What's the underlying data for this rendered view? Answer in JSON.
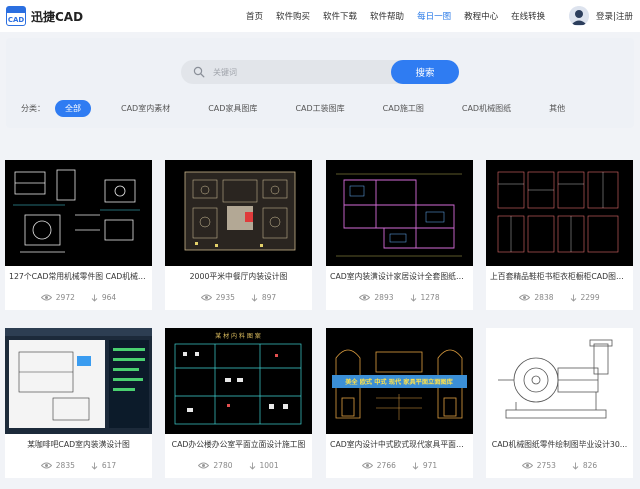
{
  "header": {
    "logo_badge": "CAD",
    "logo_text": "迅捷CAD",
    "nav": [
      {
        "label": "首页",
        "active": false
      },
      {
        "label": "软件购买",
        "active": false
      },
      {
        "label": "软件下载",
        "active": false
      },
      {
        "label": "软件帮助",
        "active": false
      },
      {
        "label": "每日一图",
        "active": true
      },
      {
        "label": "教程中心",
        "active": false
      },
      {
        "label": "在线转换",
        "active": false
      }
    ],
    "login": "登录|注册"
  },
  "search": {
    "placeholder": "关键词",
    "button": "搜索"
  },
  "categories": {
    "label": "分类：",
    "items": [
      {
        "label": "全部",
        "active": true
      },
      {
        "label": "CAD室内素材",
        "active": false
      },
      {
        "label": "CAD家具图库",
        "active": false
      },
      {
        "label": "CAD工装图库",
        "active": false
      },
      {
        "label": "CAD施工图",
        "active": false
      },
      {
        "label": "CAD机械图纸",
        "active": false
      },
      {
        "label": "其他",
        "active": false
      }
    ]
  },
  "cards": [
    {
      "title": "127个CAD常用机械零件图 CAD机械零...",
      "views": "2972",
      "downloads": "964"
    },
    {
      "title": "2000平米中餐厅内装设计图",
      "views": "2935",
      "downloads": "897"
    },
    {
      "title": "CAD室内装潢设计家居设计全套图纸案例",
      "views": "2893",
      "downloads": "1278"
    },
    {
      "title": "上百套精品鞋柜书柜衣柜橱柜CAD图库...",
      "views": "2838",
      "downloads": "2299"
    },
    {
      "title": "某咖啡吧CAD室内装潢设计图",
      "views": "2835",
      "downloads": "617"
    },
    {
      "title": "CAD办公楼办公室平面立面设计施工图",
      "views": "2780",
      "downloads": "1001"
    },
    {
      "title": "CAD室内设计中式欧式现代家具平面立...",
      "views": "2766",
      "downloads": "971"
    },
    {
      "title": "CAD机械图纸零件绘制图毕业设计30...",
      "views": "2753",
      "downloads": "826"
    }
  ],
  "thumb_texts": {
    "office_banner": "某 材 内 料 图 案",
    "furniture_banner": "美全 欧式 中式 现代 家具平面立面图库"
  },
  "colors": {
    "accent": "#2f7cf2",
    "active_nav": "#2b7be8"
  }
}
